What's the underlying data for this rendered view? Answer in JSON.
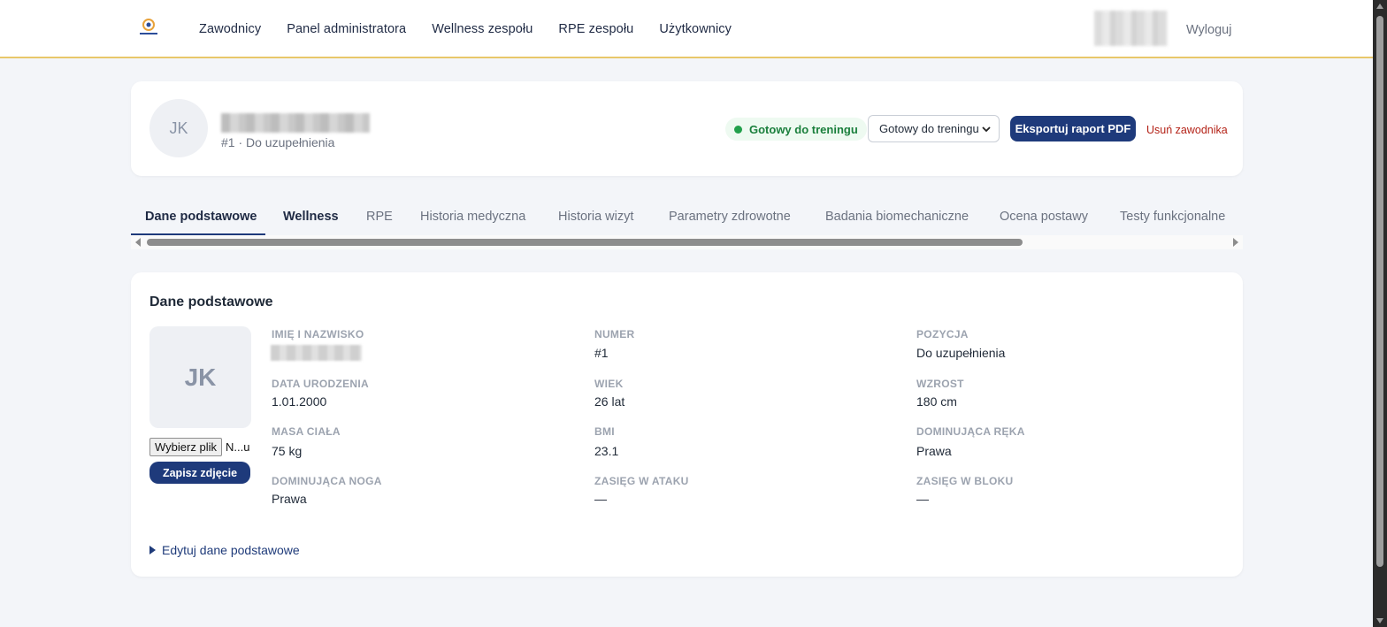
{
  "nav": {
    "items": [
      "Zawodnicy",
      "Panel administratora",
      "Wellness zespołu",
      "RPE zespołu",
      "Użytkownicy"
    ],
    "logout": "Wyloguj"
  },
  "header": {
    "avatar_initials": "JK",
    "subline": "#1 · Do uzupełnienia",
    "status_badge": "Gotowy do treningu",
    "status_select": "Gotowy do treningu",
    "export_button": "Eksportuj raport PDF",
    "remove_link": "Usuń zawodnika"
  },
  "tabs": [
    "Dane podstawowe",
    "Wellness",
    "RPE",
    "Historia medyczna",
    "Historia wizyt",
    "Parametry zdrowotne",
    "Badania biomechaniczne",
    "Ocena postawy",
    "Testy funkcjonalne"
  ],
  "basic": {
    "title": "Dane podstawowe",
    "photo_initials": "JK",
    "file_button": "Wybierz plik",
    "file_name": "N...u",
    "save_photo": "Zapisz zdjęcie",
    "fields": [
      {
        "label": "IMIĘ I NAZWISKO",
        "value": ""
      },
      {
        "label": "NUMER",
        "value": "#1"
      },
      {
        "label": "POZYCJA",
        "value": "Do uzupełnienia"
      },
      {
        "label": "DATA URODZENIA",
        "value": "1.01.2000"
      },
      {
        "label": "WIEK",
        "value": "26 lat"
      },
      {
        "label": "WZROST",
        "value": "180 cm"
      },
      {
        "label": "MASA CIAŁA",
        "value": "75 kg"
      },
      {
        "label": "BMI",
        "value": "23.1"
      },
      {
        "label": "DOMINUJĄCA RĘKA",
        "value": "Prawa"
      },
      {
        "label": "DOMINUJĄCA NOGA",
        "value": "Prawa"
      },
      {
        "label": "ZASIĘG W ATAKU",
        "value": "—"
      },
      {
        "label": "ZASIĘG W BLOKU",
        "value": "—"
      }
    ],
    "edit_toggle": "Edytuj dane podstawowe"
  },
  "colors": {
    "primary": "#1e3a7b",
    "accent_line": "#e8c76a",
    "status_green": "#22a04b",
    "danger": "#b42318"
  }
}
